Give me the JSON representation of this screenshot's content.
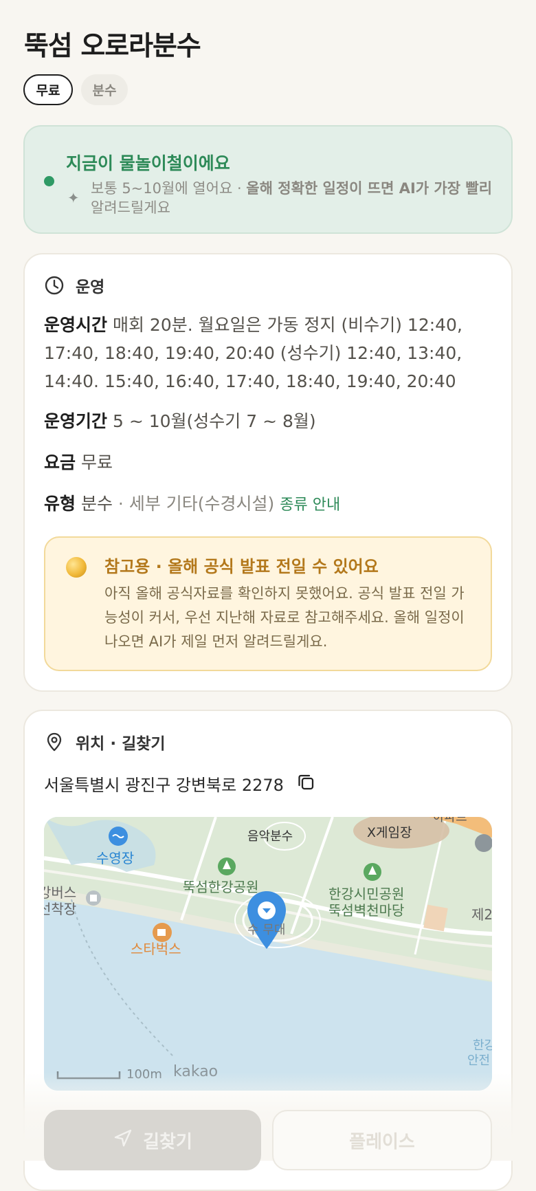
{
  "header": {
    "title": "뚝섬 오로라분수"
  },
  "chips": [
    {
      "label": "무료"
    },
    {
      "label": "분수"
    }
  ],
  "season_notice": {
    "title": "지금이 물놀이철이에요",
    "desc_prefix": "보통 5~10월에 열어요 · ",
    "desc_bold": "올해 정확한 일정이 뜨면 AI가 가장 빨리",
    "desc_suffix": "알려드릴게요",
    "dot_color": "#2f9a65"
  },
  "operation": {
    "heading": "운영",
    "icon": "clock-icon",
    "hours_label": "운영시간",
    "hours_value": "매회 20분. 월요일은 가동 정지 (비수기) 12:40, 17:40, 18:40, 19:40, 20:40 (성수기) 12:40, 13:40, 14:40. 15:40, 16:40, 17:40, 18:40, 19:40, 20:40",
    "period_label": "운영기간",
    "period_value": "5 ~ 10월(성수기 7 ~ 8월)",
    "fee_label": "요금",
    "fee_value": "무료",
    "type_label": "유형",
    "type_value": "분수",
    "type_detail": " · 세부 기타(수경시설)",
    "type_link": "종류 안내",
    "notice": {
      "title": "참고용 · 올해 공식 발표 전일 수 있어요",
      "body": "아직 올해 공식자료를 확인하지 못했어요. 공식 발표 전일 가능성이 커서, 우선 지난해 자료로 참고해주세요. 올해 일정이 나오면 AI가 제일 먼저 알려드릴게요.",
      "icon": "coin-icon"
    }
  },
  "location": {
    "heading": "위치 · 길찾기",
    "icon": "location-pin-icon",
    "address": "서울특별시 광진구 강변북로 2278",
    "copy_icon": "copy-icon",
    "map": {
      "labels": {
        "pool": "수영장",
        "music_fountain": "음악분수",
        "x_game": "X게임장",
        "park": "뚝섬한강공원",
        "citizen_park": "한강시민공원",
        "citizen_park2": "뚝섬벽천마당",
        "bus_stop1": "강버스",
        "bus_stop2": "선착장",
        "starbucks": "스타벅스",
        "fountain_partial": "수  무대",
        "edge_right": "제2",
        "edge_bottom1": "한강",
        "edge_bottom2": "안전",
        "top_right": "아파트"
      },
      "scale": "100m",
      "provider": "kakao",
      "water_color": "#cde3ee",
      "land_color": "#dde9d6",
      "pin_color": "#3d8fe0"
    }
  },
  "actions": {
    "directions": "길찾기",
    "place": "플레이스"
  }
}
